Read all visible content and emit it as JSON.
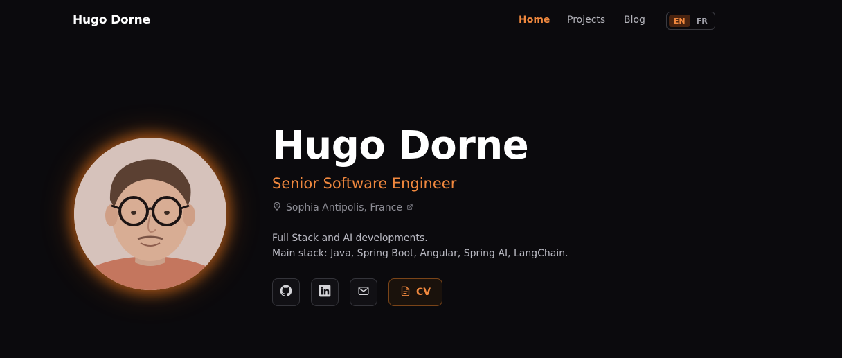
{
  "header": {
    "brand": "Hugo Dorne",
    "nav": [
      {
        "label": "Home",
        "active": true
      },
      {
        "label": "Projects",
        "active": false
      },
      {
        "label": "Blog",
        "active": false
      }
    ],
    "languages": [
      {
        "label": "EN",
        "active": true
      },
      {
        "label": "FR",
        "active": false
      }
    ]
  },
  "hero": {
    "name": "Hugo Dorne",
    "role": "Senior Software Engineer",
    "location": "Sophia Antipolis, France",
    "description_line1": "Full Stack and AI developments.",
    "description_line2": "Main stack: Java, Spring Boot, Angular, Spring AI, LangChain.",
    "cv_label": "CV",
    "socials": [
      {
        "icon": "github-icon"
      },
      {
        "icon": "linkedin-icon"
      },
      {
        "icon": "mail-icon"
      }
    ]
  },
  "colors": {
    "accent": "#f0883e",
    "background": "#0b0a0d"
  }
}
